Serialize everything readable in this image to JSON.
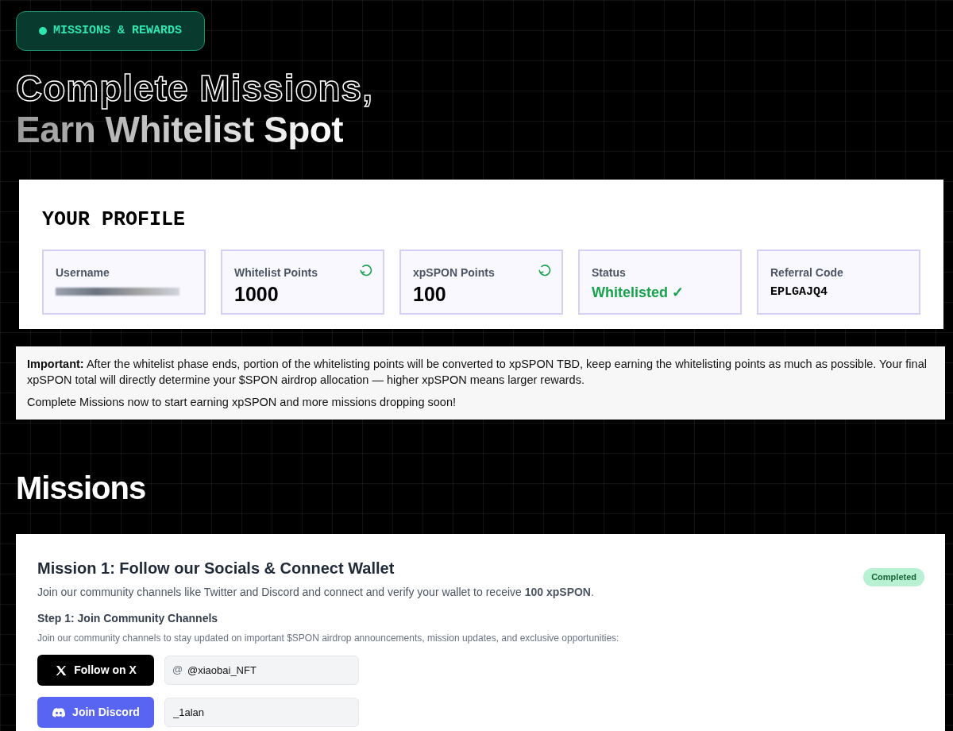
{
  "badge": {
    "label": "MISSIONS & REWARDS"
  },
  "headline": {
    "line_1": "Complete Missions,",
    "line_2": "Earn Whitelist Spot"
  },
  "profile": {
    "title": "YOUR PROFILE",
    "stats": [
      {
        "label": "Username",
        "kind": "redacted",
        "refreshable": false
      },
      {
        "label": "Whitelist Points",
        "value": "1000",
        "kind": "number",
        "refreshable": true
      },
      {
        "label": "xpSPON Points",
        "value": "100",
        "kind": "number",
        "refreshable": true
      },
      {
        "label": "Status",
        "value": "Whitelisted ✓",
        "kind": "status",
        "refreshable": false
      },
      {
        "label": "Referral Code",
        "value": "EPLGAJQ4",
        "kind": "code",
        "refreshable": false
      }
    ]
  },
  "notice": {
    "paragraphs": [
      "**Important:** After the whitelist phase ends, portion of the whitelisting points will be converted to xpSPON TBD, keep earning the whitelisting points as much as possible. Your final xpSPON total will directly determine your $SPON airdrop allocation — higher xpSPON means larger rewards.",
      "Complete Missions now to start earning xpSPON and more missions dropping soon!"
    ]
  },
  "missions_heading": "Missions",
  "missions": [
    {
      "title": "Mission 1: Follow our Socials & Connect Wallet",
      "description": "Join our community channels like Twitter and Discord and connect and verify your wallet to receive **100 xpSPON**.",
      "status": "Completed",
      "steps": [
        {
          "title": "Step 1: Join Community Channels",
          "description": "Join our community channels to stay updated on important $SPON airdrop announcements, mission updates, and exclusive opportunities:",
          "actions": [
            {
              "kind": "x",
              "label": "Follow on X",
              "input": {
                "prefix": "@",
                "value": "@xiaobai_NFT"
              }
            },
            {
              "kind": "discord",
              "label": "Join Discord",
              "input": {
                "value": "_1alan"
              }
            }
          ]
        }
      ]
    }
  ]
}
